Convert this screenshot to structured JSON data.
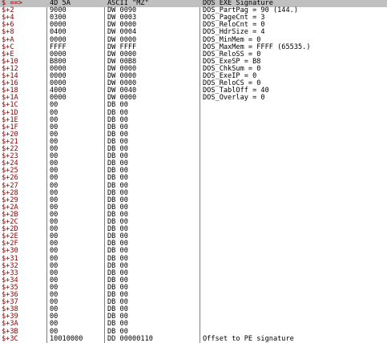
{
  "dump": {
    "rows": [
      {
        "addr": "$ ==>",
        "hex": "4D 5A",
        "disasm": "ASCII \"MZ\"",
        "comment": "DOS EXE Signature",
        "current": true
      },
      {
        "addr": "$+2",
        "hex": "9000",
        "disasm": "DW 0090",
        "comment": "DOS_PartPag = 90 (144.)"
      },
      {
        "addr": "$+4",
        "hex": "0300",
        "disasm": "DW 0003",
        "comment": "DOS_PageCnt = 3"
      },
      {
        "addr": "$+6",
        "hex": "0000",
        "disasm": "DW 0000",
        "comment": "DOS_ReloCnt = 0"
      },
      {
        "addr": "$+8",
        "hex": "0400",
        "disasm": "DW 0004",
        "comment": "DOS_HdrSize = 4"
      },
      {
        "addr": "$+A",
        "hex": "0000",
        "disasm": "DW 0000",
        "comment": "DOS_MinMem = 0"
      },
      {
        "addr": "$+C",
        "hex": "FFFF",
        "disasm": "DW FFFF",
        "comment": "DOS_MaxMem = FFFF (65535.)"
      },
      {
        "addr": "$+E",
        "hex": "0000",
        "disasm": "DW 0000",
        "comment": "DOS_ReloSS = 0"
      },
      {
        "addr": "$+10",
        "hex": "B800",
        "disasm": "DW 00B8",
        "comment": "DOS_ExeSP = B8"
      },
      {
        "addr": "$+12",
        "hex": "0000",
        "disasm": "DW 0000",
        "comment": "DOS_ChkSum = 0"
      },
      {
        "addr": "$+14",
        "hex": "0000",
        "disasm": "DW 0000",
        "comment": "DOS_ExeIP = 0"
      },
      {
        "addr": "$+16",
        "hex": "0000",
        "disasm": "DW 0000",
        "comment": "DOS_ReloCS = 0"
      },
      {
        "addr": "$+18",
        "hex": "4000",
        "disasm": "DW 0040",
        "comment": "DOS_TablOff = 40"
      },
      {
        "addr": "$+1A",
        "hex": "0000",
        "disasm": "DW 0000",
        "comment": "DOS_Overlay = 0"
      },
      {
        "addr": "$+1C",
        "hex": "00",
        "disasm": "DB 00",
        "comment": ""
      },
      {
        "addr": "$+1D",
        "hex": "00",
        "disasm": "DB 00",
        "comment": ""
      },
      {
        "addr": "$+1E",
        "hex": "00",
        "disasm": "DB 00",
        "comment": ""
      },
      {
        "addr": "$+1F",
        "hex": "00",
        "disasm": "DB 00",
        "comment": ""
      },
      {
        "addr": "$+20",
        "hex": "00",
        "disasm": "DB 00",
        "comment": ""
      },
      {
        "addr": "$+21",
        "hex": "00",
        "disasm": "DB 00",
        "comment": ""
      },
      {
        "addr": "$+22",
        "hex": "00",
        "disasm": "DB 00",
        "comment": ""
      },
      {
        "addr": "$+23",
        "hex": "00",
        "disasm": "DB 00",
        "comment": ""
      },
      {
        "addr": "$+24",
        "hex": "00",
        "disasm": "DB 00",
        "comment": ""
      },
      {
        "addr": "$+25",
        "hex": "00",
        "disasm": "DB 00",
        "comment": ""
      },
      {
        "addr": "$+26",
        "hex": "00",
        "disasm": "DB 00",
        "comment": ""
      },
      {
        "addr": "$+27",
        "hex": "00",
        "disasm": "DB 00",
        "comment": ""
      },
      {
        "addr": "$+28",
        "hex": "00",
        "disasm": "DB 00",
        "comment": ""
      },
      {
        "addr": "$+29",
        "hex": "00",
        "disasm": "DB 00",
        "comment": ""
      },
      {
        "addr": "$+2A",
        "hex": "00",
        "disasm": "DB 00",
        "comment": ""
      },
      {
        "addr": "$+2B",
        "hex": "00",
        "disasm": "DB 00",
        "comment": ""
      },
      {
        "addr": "$+2C",
        "hex": "00",
        "disasm": "DB 00",
        "comment": ""
      },
      {
        "addr": "$+2D",
        "hex": "00",
        "disasm": "DB 00",
        "comment": ""
      },
      {
        "addr": "$+2E",
        "hex": "00",
        "disasm": "DB 00",
        "comment": ""
      },
      {
        "addr": "$+2F",
        "hex": "00",
        "disasm": "DB 00",
        "comment": ""
      },
      {
        "addr": "$+30",
        "hex": "00",
        "disasm": "DB 00",
        "comment": ""
      },
      {
        "addr": "$+31",
        "hex": "00",
        "disasm": "DB 00",
        "comment": ""
      },
      {
        "addr": "$+32",
        "hex": "00",
        "disasm": "DB 00",
        "comment": ""
      },
      {
        "addr": "$+33",
        "hex": "00",
        "disasm": "DB 00",
        "comment": ""
      },
      {
        "addr": "$+34",
        "hex": "00",
        "disasm": "DB 00",
        "comment": ""
      },
      {
        "addr": "$+35",
        "hex": "00",
        "disasm": "DB 00",
        "comment": ""
      },
      {
        "addr": "$+36",
        "hex": "00",
        "disasm": "DB 00",
        "comment": ""
      },
      {
        "addr": "$+37",
        "hex": "00",
        "disasm": "DB 00",
        "comment": ""
      },
      {
        "addr": "$+38",
        "hex": "00",
        "disasm": "DB 00",
        "comment": ""
      },
      {
        "addr": "$+39",
        "hex": "00",
        "disasm": "DB 00",
        "comment": ""
      },
      {
        "addr": "$+3A",
        "hex": "00",
        "disasm": "DB 00",
        "comment": ""
      },
      {
        "addr": "$+3B",
        "hex": "00",
        "disasm": "DB 00",
        "comment": ""
      },
      {
        "addr": "$+3C",
        "hex": "10010000",
        "disasm": "DD 00000110",
        "comment": "Offset to PE signature"
      }
    ]
  },
  "colors": {
    "address": "#8b0000",
    "text": "#000000",
    "selected_row": "#c0c0c0",
    "separator": "#808080",
    "background": "#ffffff"
  }
}
